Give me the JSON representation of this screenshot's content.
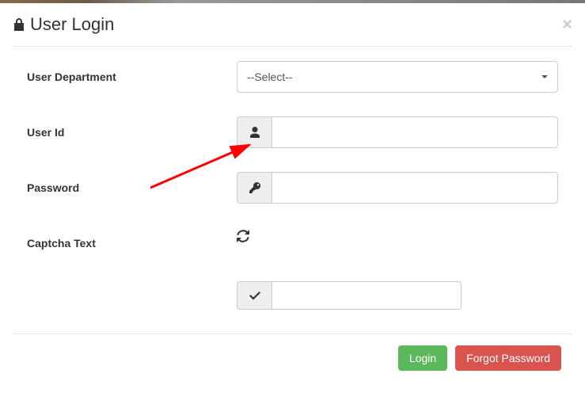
{
  "header": {
    "title": "User Login"
  },
  "form": {
    "department": {
      "label": "User Department",
      "selected": "--Select--"
    },
    "userId": {
      "label": "User Id",
      "value": ""
    },
    "password": {
      "label": "Password",
      "value": ""
    },
    "captcha": {
      "label": "Captcha Text",
      "value": ""
    }
  },
  "footer": {
    "login": "Login",
    "forgot": "Forgot Password"
  },
  "colors": {
    "success": "#5cb85c",
    "danger": "#d9534f"
  }
}
